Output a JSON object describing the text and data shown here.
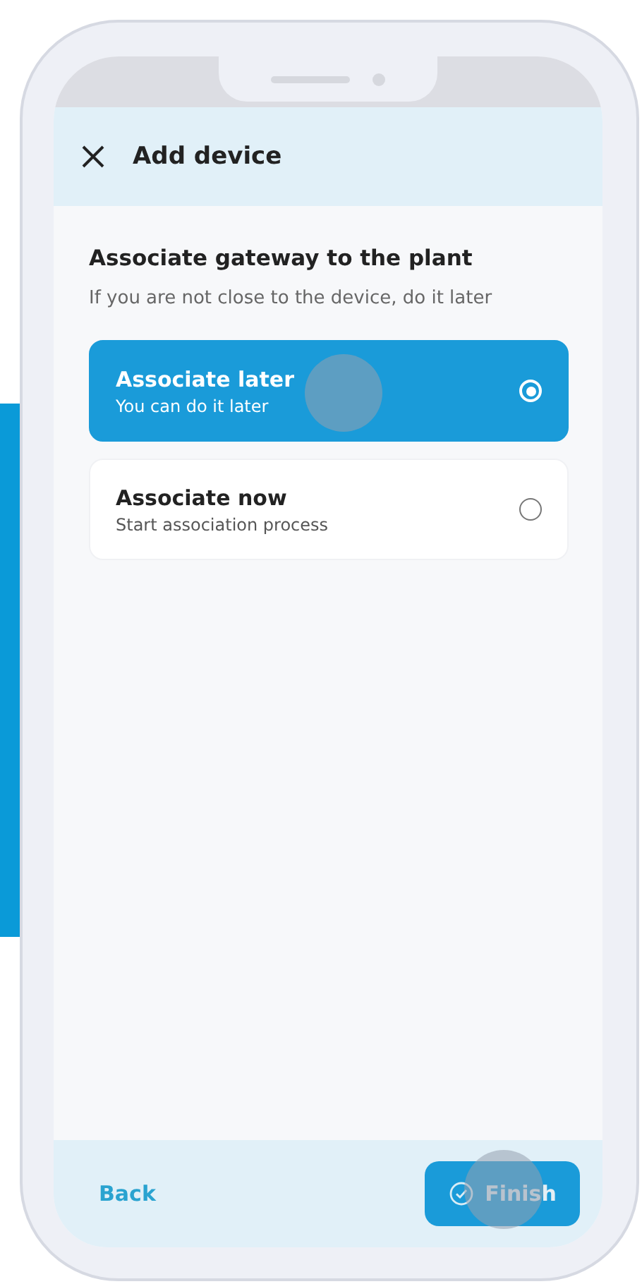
{
  "header": {
    "title": "Add device"
  },
  "section": {
    "title": "Associate gateway to the plant",
    "subtitle": "If you are not close to the device, do it later"
  },
  "options": [
    {
      "title": "Associate later",
      "subtitle": "You can do it later",
      "selected": true
    },
    {
      "title": "Associate now",
      "subtitle": "Start association process",
      "selected": false
    }
  ],
  "footer": {
    "back": "Back",
    "finish": "Finish"
  }
}
